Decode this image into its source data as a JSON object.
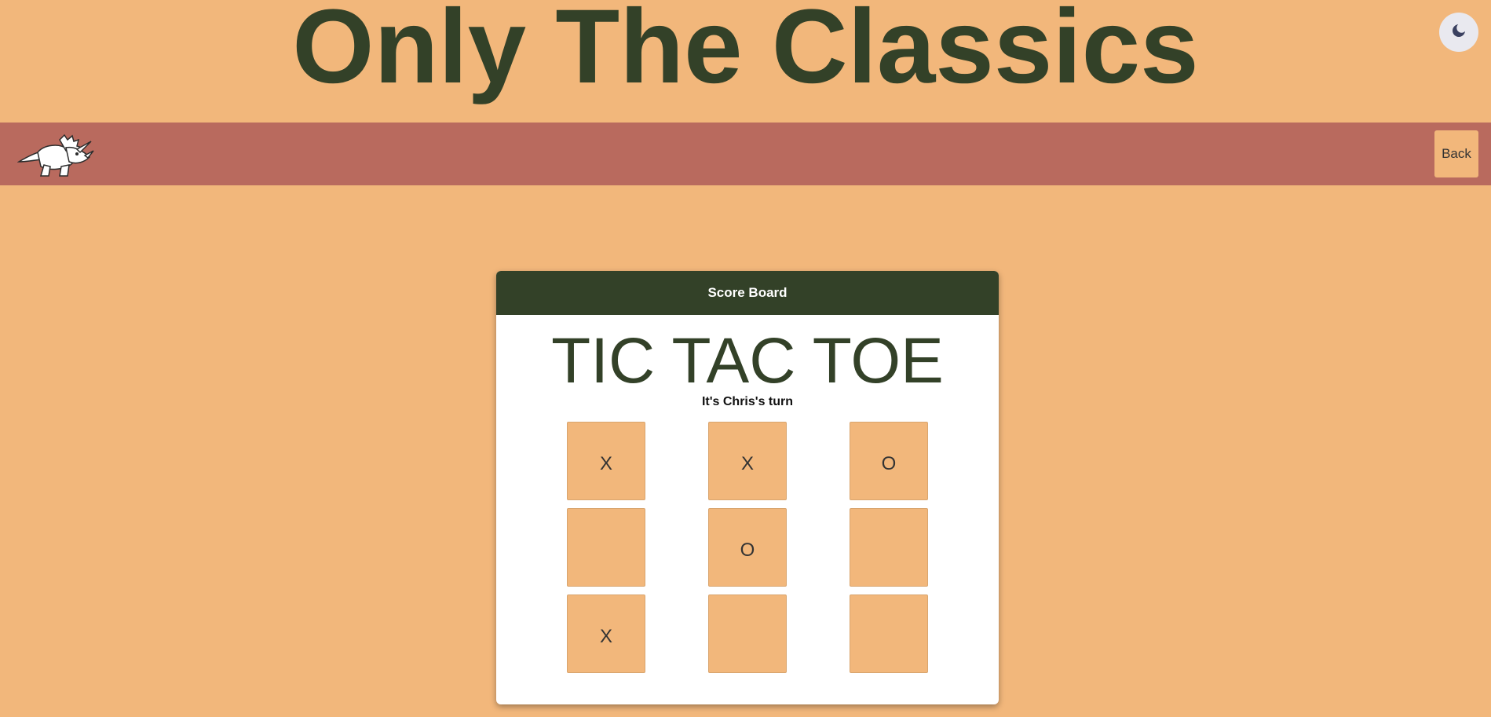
{
  "header": {
    "site_title": "Only The Classics"
  },
  "theme_toggle": {
    "icon": "moon-icon"
  },
  "navbar": {
    "logo_icon": "triceratops-logo-icon",
    "back_label": "Back"
  },
  "scoreboard": {
    "header_label": "Score Board",
    "game_title": "TIC TAC TOE",
    "turn_text": "It's Chris's turn",
    "cells": [
      "X",
      "X",
      "O",
      "",
      "O",
      "",
      "X",
      "",
      ""
    ]
  },
  "colors": {
    "background": "#f2b77b",
    "navbar": "#b96a5e",
    "accent_dark_green": "#334128",
    "card": "#ffffff"
  }
}
